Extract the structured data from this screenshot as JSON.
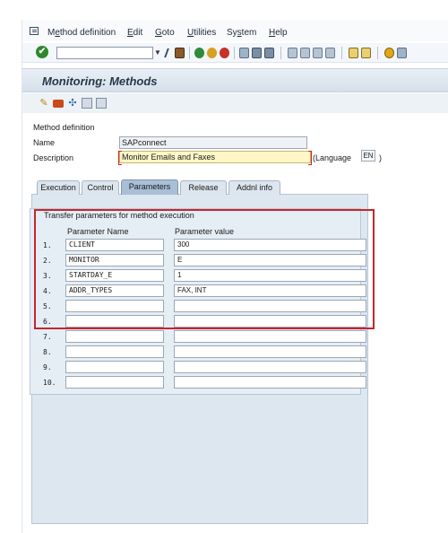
{
  "menu": {
    "items": [
      {
        "pre": "M",
        "ul": "e",
        "post": "thod definition"
      },
      {
        "pre": "",
        "ul": "E",
        "post": "dit"
      },
      {
        "pre": "",
        "ul": "G",
        "post": "oto"
      },
      {
        "pre": "",
        "ul": "U",
        "post": "tilities"
      },
      {
        "pre": "Sy",
        "ul": "s",
        "post": "tem"
      },
      {
        "pre": "",
        "ul": "H",
        "post": "elp"
      }
    ]
  },
  "toolbar": {
    "command_field_value": "",
    "enter_icon": "✔",
    "dropdown_icon": "▼"
  },
  "page_title": "Monitoring: Methods",
  "form": {
    "section_label": "Method definition",
    "name_label": "Name",
    "name_value": "SAPconnect",
    "description_label": "Description",
    "description_value": "Monitor Emails and Faxes",
    "language_label": "(Language",
    "language_value": "EN",
    "language_close": ")"
  },
  "tabs": [
    "Execution",
    "Control",
    "Parameters",
    "Release",
    "Addnl info"
  ],
  "active_tab": "Parameters",
  "parameters": {
    "group_title": "Transfer parameters for method execution",
    "col_name": "Parameter Name",
    "col_value": "Parameter value",
    "rows": [
      {
        "num": "1.",
        "name": "CLIENT",
        "value": "300"
      },
      {
        "num": "2.",
        "name": "MONITOR",
        "value": "E"
      },
      {
        "num": "3.",
        "name": "STARTDAY_E",
        "value": "1"
      },
      {
        "num": "4.",
        "name": "ADDR_TYPES",
        "value": "FAX, INT"
      },
      {
        "num": "5.",
        "name": "",
        "value": ""
      },
      {
        "num": "6.",
        "name": "",
        "value": ""
      },
      {
        "num": "7.",
        "name": "",
        "value": ""
      },
      {
        "num": "8.",
        "name": "",
        "value": ""
      },
      {
        "num": "9.",
        "name": "",
        "value": ""
      },
      {
        "num": "10.",
        "name": "",
        "value": ""
      }
    ]
  },
  "colors": {
    "highlight": "#c4262e",
    "title_bar": "#d6e0ea",
    "active_tab": "#a9bfd6",
    "required_field": "#fff7c7"
  },
  "icons": {
    "system_menu": "system-menu-icon",
    "toolbar": [
      "back-icon",
      "save-icon",
      "back-green-icon",
      "exit-icon",
      "cancel-icon",
      "print-icon",
      "find-icon",
      "find-next-icon",
      "first-page-icon",
      "previous-page-icon",
      "next-page-icon",
      "last-page-icon",
      "create-session-icon",
      "shortcut-icon",
      "help-icon",
      "layout-menu-icon"
    ],
    "app_toolbar": [
      "change-display-icon",
      "transport-icon",
      "other-object-icon",
      "copy-icon",
      "check-icon"
    ]
  }
}
